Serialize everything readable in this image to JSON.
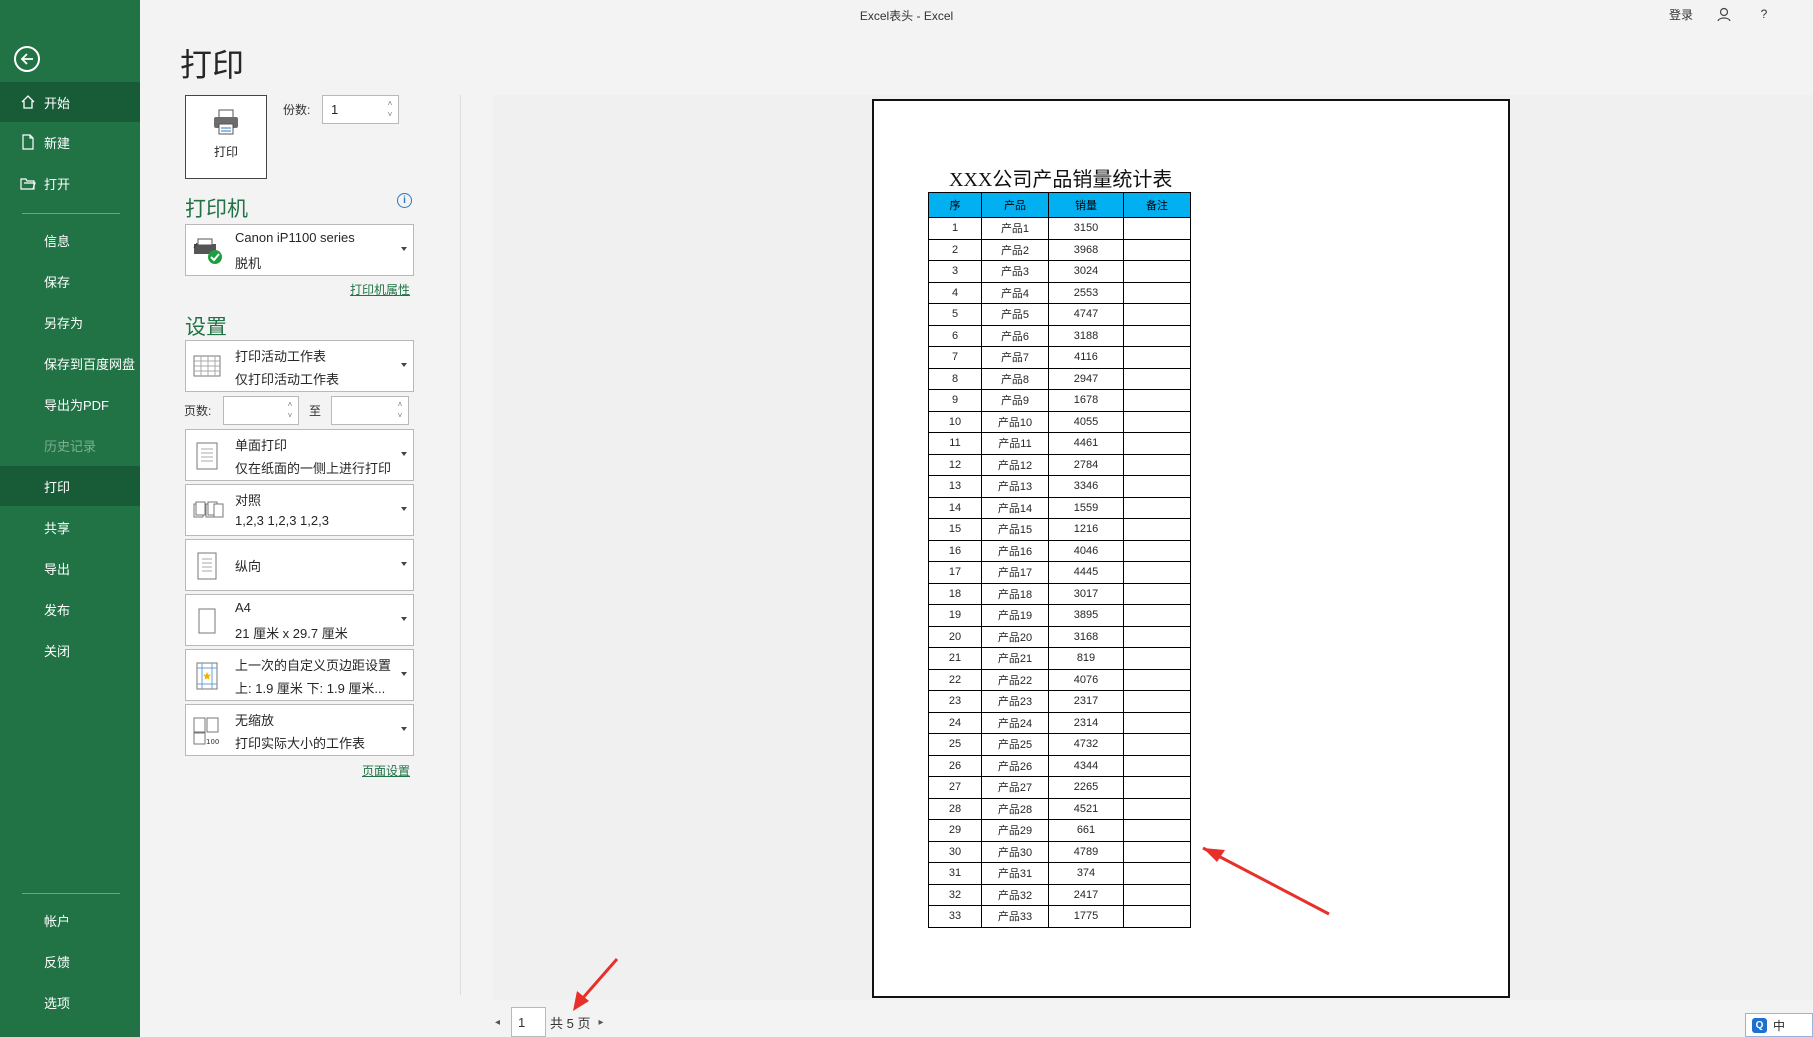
{
  "window": {
    "title": "Excel表头  -  Excel",
    "login_label": "登录",
    "help_label": "?"
  },
  "sidebar": {
    "top_items": [
      {
        "label": "开始",
        "icon": "home-icon"
      },
      {
        "label": "新建",
        "icon": "new-doc-icon"
      },
      {
        "label": "打开",
        "icon": "folder-open-icon"
      }
    ],
    "mid_items": [
      "信息",
      "保存",
      "另存为",
      "保存到百度网盘",
      "导出为PDF",
      "历史记录",
      "打印",
      "共享",
      "导出",
      "发布",
      "关闭"
    ],
    "bottom_items": [
      "帐户",
      "反馈",
      "选项"
    ],
    "active": "打印",
    "disabled": "历史记录"
  },
  "page_title": "打印",
  "print_button_label": "打印",
  "copies": {
    "label": "份数:",
    "value": "1"
  },
  "printer": {
    "heading": "打印机",
    "name": "Canon iP1100 series",
    "status": "脱机",
    "properties_link": "打印机属性"
  },
  "settings": {
    "heading": "设置",
    "what": {
      "line1": "打印活动工作表",
      "line2": "仅打印活动工作表"
    },
    "pages_label": "页数:",
    "to_label": "至",
    "pages_from": "",
    "pages_to": "",
    "sides": {
      "line1": "单面打印",
      "line2": "仅在纸面的一侧上进行打印"
    },
    "collate": {
      "line1": "对照",
      "line2": "1,2,3    1,2,3    1,2,3"
    },
    "orientation": {
      "line1": "纵向"
    },
    "paper": {
      "line1": "A4",
      "line2": "21 厘米 x 29.7 厘米"
    },
    "margins": {
      "line1": "上一次的自定义页边距设置",
      "line2": "上: 1.9 厘米 下: 1.9 厘米..."
    },
    "scaling": {
      "line1": "无缩放",
      "line2": "打印实际大小的工作表"
    },
    "page_setup_link": "页面设置"
  },
  "preview": {
    "sheet_title": "XXX公司产品销量统计表",
    "headers": [
      "序",
      "产品",
      "销量",
      "备注"
    ],
    "rows": [
      [
        "1",
        "产品1",
        "3150",
        ""
      ],
      [
        "2",
        "产品2",
        "3968",
        ""
      ],
      [
        "3",
        "产品3",
        "3024",
        ""
      ],
      [
        "4",
        "产品4",
        "2553",
        ""
      ],
      [
        "5",
        "产品5",
        "4747",
        ""
      ],
      [
        "6",
        "产品6",
        "3188",
        ""
      ],
      [
        "7",
        "产品7",
        "4116",
        ""
      ],
      [
        "8",
        "产品8",
        "2947",
        ""
      ],
      [
        "9",
        "产品9",
        "1678",
        ""
      ],
      [
        "10",
        "产品10",
        "4055",
        ""
      ],
      [
        "11",
        "产品11",
        "4461",
        ""
      ],
      [
        "12",
        "产品12",
        "2784",
        ""
      ],
      [
        "13",
        "产品13",
        "3346",
        ""
      ],
      [
        "14",
        "产品14",
        "1559",
        ""
      ],
      [
        "15",
        "产品15",
        "1216",
        ""
      ],
      [
        "16",
        "产品16",
        "4046",
        ""
      ],
      [
        "17",
        "产品17",
        "4445",
        ""
      ],
      [
        "18",
        "产品18",
        "3017",
        ""
      ],
      [
        "19",
        "产品19",
        "3895",
        ""
      ],
      [
        "20",
        "产品20",
        "3168",
        ""
      ],
      [
        "21",
        "产品21",
        "819",
        ""
      ],
      [
        "22",
        "产品22",
        "4076",
        ""
      ],
      [
        "23",
        "产品23",
        "2317",
        ""
      ],
      [
        "24",
        "产品24",
        "2314",
        ""
      ],
      [
        "25",
        "产品25",
        "4732",
        ""
      ],
      [
        "26",
        "产品26",
        "4344",
        ""
      ],
      [
        "27",
        "产品27",
        "2265",
        ""
      ],
      [
        "28",
        "产品28",
        "4521",
        ""
      ],
      [
        "29",
        "产品29",
        "661",
        ""
      ],
      [
        "30",
        "产品30",
        "4789",
        ""
      ],
      [
        "31",
        "产品31",
        "374",
        ""
      ],
      [
        "32",
        "产品32",
        "2417",
        ""
      ],
      [
        "33",
        "产品33",
        "1775",
        ""
      ]
    ]
  },
  "pager": {
    "current": "1",
    "total_text": "共 5 页"
  },
  "ime": {
    "label": "中"
  },
  "colors": {
    "sidebar": "#217346",
    "accent": "#217346",
    "header_fill": "#00b0f0",
    "annotation": "#e8302a"
  }
}
